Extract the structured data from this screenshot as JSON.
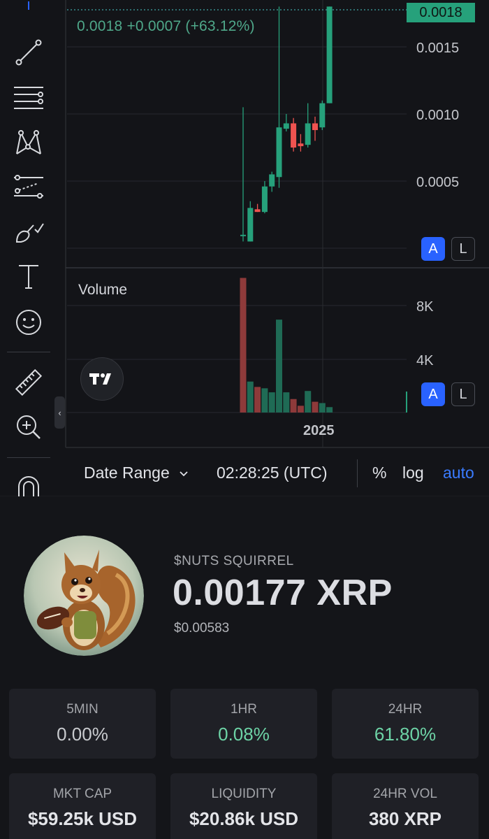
{
  "chart": {
    "last_price_tag": "0.0018",
    "price_change": "0.0018  +0.0007 (+63.12%)",
    "price_axis": [
      "0.0015",
      "0.0010",
      "0.0005"
    ],
    "volume_title": "Volume",
    "volume_axis": [
      "8K",
      "4K"
    ],
    "x_axis_label": "2025",
    "scale_buttons": {
      "auto": "A",
      "log": "L"
    },
    "colors": {
      "up": "#26a17b",
      "down": "#ef5350",
      "accent": "#2962ff",
      "link": "#3a7bff"
    }
  },
  "chart_data": {
    "type": "candlestick",
    "price_ylim": [
      0,
      0.0018
    ],
    "candles": [
      {
        "o": 0.0001,
        "h": 0.00105,
        "l": 5e-05,
        "c": 0.0001
      },
      {
        "o": 5e-05,
        "h": 0.00035,
        "l": 5e-05,
        "c": 0.0003
      },
      {
        "o": 0.00029,
        "h": 0.00033,
        "l": 0.00027,
        "c": 0.00027
      },
      {
        "o": 0.00027,
        "h": 0.0005,
        "l": 0.00026,
        "c": 0.00046
      },
      {
        "o": 0.00046,
        "h": 0.00057,
        "l": 0.00042,
        "c": 0.00055
      },
      {
        "o": 0.00053,
        "h": 0.0018,
        "l": 0.00045,
        "c": 0.0009
      },
      {
        "o": 0.00089,
        "h": 0.001,
        "l": 0.00087,
        "c": 0.00093
      },
      {
        "o": 0.00093,
        "h": 0.00097,
        "l": 0.00072,
        "c": 0.00075
      },
      {
        "o": 0.00078,
        "h": 0.00085,
        "l": 0.00072,
        "c": 0.00076
      },
      {
        "o": 0.00077,
        "h": 0.00108,
        "l": 0.00075,
        "c": 0.00093
      },
      {
        "o": 0.00093,
        "h": 0.00098,
        "l": 0.0008,
        "c": 0.00088
      },
      {
        "o": 0.0009,
        "h": 0.0011,
        "l": 0.00088,
        "c": 0.00108
      },
      {
        "o": 0.00108,
        "h": 0.0018,
        "l": 0.00108,
        "c": 0.0018
      }
    ],
    "volume_ylim": [
      0,
      10000
    ],
    "volumes": [
      {
        "v": 10000,
        "up": false
      },
      {
        "v": 2300,
        "up": true
      },
      {
        "v": 1900,
        "up": false
      },
      {
        "v": 1800,
        "up": true
      },
      {
        "v": 1500,
        "up": true
      },
      {
        "v": 6900,
        "up": true
      },
      {
        "v": 1500,
        "up": true
      },
      {
        "v": 1000,
        "up": false
      },
      {
        "v": 500,
        "up": false
      },
      {
        "v": 1600,
        "up": true
      },
      {
        "v": 800,
        "up": false
      },
      {
        "v": 700,
        "up": true
      },
      {
        "v": 400,
        "up": true
      }
    ]
  },
  "bottom_bar": {
    "date_range": "Date Range",
    "time": "02:28:25 (UTC)",
    "percent": "%",
    "log": "log",
    "auto": "auto"
  },
  "token": {
    "name": "$NUTS SQUIRREL",
    "price": "0.00177 XRP",
    "usd_price": "$0.00583"
  },
  "stats": [
    {
      "label": "5MIN",
      "value": "0.00%"
    },
    {
      "label": "1HR",
      "value": "0.08%"
    },
    {
      "label": "24HR",
      "value": "61.80%"
    },
    {
      "label": "MKT CAP",
      "value": "$59.25k USD"
    },
    {
      "label": "LIQUIDITY",
      "value": "$20.86k USD"
    },
    {
      "label": "24HR VOL",
      "value": "380 XRP"
    }
  ]
}
